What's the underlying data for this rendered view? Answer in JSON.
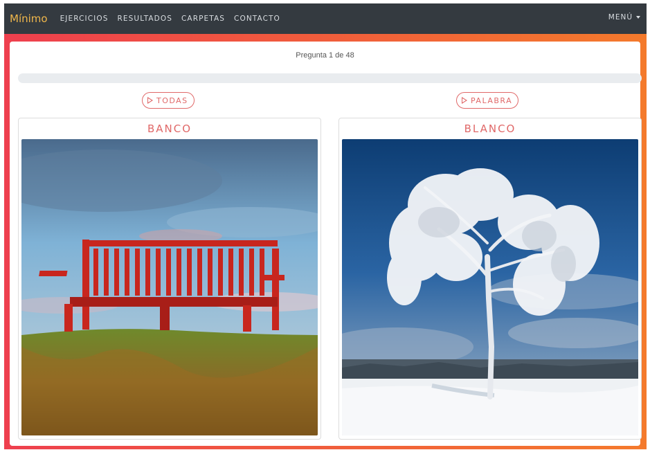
{
  "navbar": {
    "brand": "Mínimo",
    "links": [
      "EJERCICIOS",
      "RESULTADOS",
      "CARPETAS",
      "CONTACTO"
    ],
    "menu_label": "MENÚ"
  },
  "quiz": {
    "question_label": "Pregunta 1 de 48",
    "progress_fraction": 0.0
  },
  "buttons": {
    "play_all_label": "TODAS",
    "play_word_label": "PALABRA"
  },
  "cards": [
    {
      "word": "BANCO",
      "image": "red-bench-on-hill"
    },
    {
      "word": "BLANCO",
      "image": "snow-covered-tree"
    }
  ],
  "colors": {
    "navbar_bg": "#343a40",
    "brand": "#f0b74b",
    "accent": "#e06868",
    "frame_gradient_start": "#ee3f4e",
    "frame_gradient_end": "#f47a2c"
  }
}
